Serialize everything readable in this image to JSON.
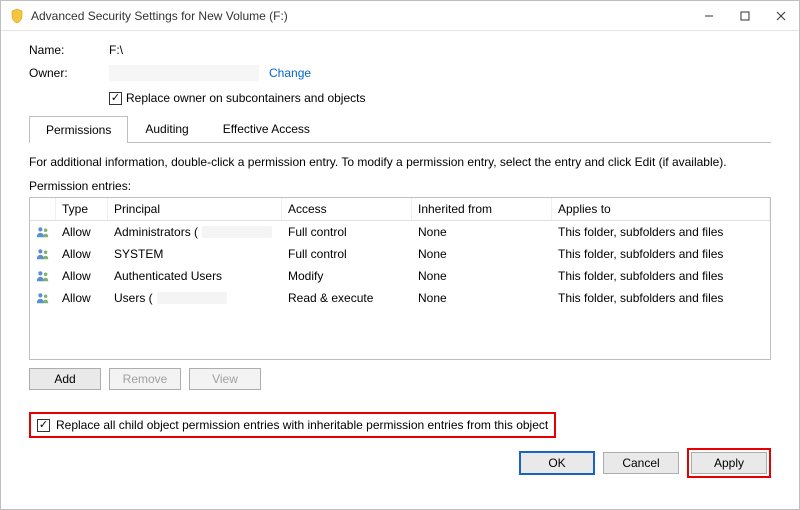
{
  "window": {
    "title": "Advanced Security Settings for New Volume (F:)"
  },
  "fields": {
    "name_label": "Name:",
    "name_value": "F:\\",
    "owner_label": "Owner:",
    "change_link": "Change",
    "replace_owner_label": "Replace owner on subcontainers and objects"
  },
  "tabs": {
    "permissions": "Permissions",
    "auditing": "Auditing",
    "effective": "Effective Access"
  },
  "info_text": "For additional information, double-click a permission entry. To modify a permission entry, select the entry and click Edit (if available).",
  "entries_label": "Permission entries:",
  "columns": {
    "type": "Type",
    "principal": "Principal",
    "access": "Access",
    "inherited": "Inherited from",
    "applies": "Applies to"
  },
  "rows": [
    {
      "type": "Allow",
      "principal": "Administrators (",
      "access": "Full control",
      "inherited": "None",
      "applies": "This folder, subfolders and files",
      "blur": true
    },
    {
      "type": "Allow",
      "principal": "SYSTEM",
      "access": "Full control",
      "inherited": "None",
      "applies": "This folder, subfolders and files",
      "blur": false
    },
    {
      "type": "Allow",
      "principal": "Authenticated Users",
      "access": "Modify",
      "inherited": "None",
      "applies": "This folder, subfolders and files",
      "blur": false
    },
    {
      "type": "Allow",
      "principal": "Users (",
      "access": "Read & execute",
      "inherited": "None",
      "applies": "This folder, subfolders and files",
      "blur": true
    }
  ],
  "buttons": {
    "add": "Add",
    "remove": "Remove",
    "view": "View",
    "ok": "OK",
    "cancel": "Cancel",
    "apply": "Apply"
  },
  "inherit_label": "Replace all child object permission entries with inheritable permission entries from this object"
}
